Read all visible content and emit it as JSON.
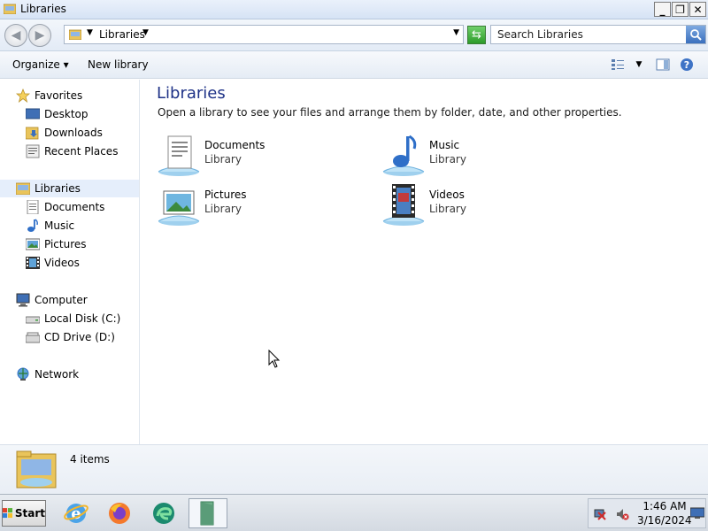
{
  "window": {
    "title": "Libraries",
    "minimize_label": "_",
    "maximize_label": "❐",
    "close_label": "✕"
  },
  "address": {
    "crumb": "Libraries",
    "search_placeholder": "Search Libraries"
  },
  "toolbar": {
    "organize_label": "Organize ▾",
    "new_library_label": "New library"
  },
  "nav": {
    "favorites": "Favorites",
    "desktop": "Desktop",
    "downloads": "Downloads",
    "recent_places": "Recent Places",
    "libraries": "Libraries",
    "documents": "Documents",
    "music": "Music",
    "pictures": "Pictures",
    "videos": "Videos",
    "computer": "Computer",
    "local_disk": "Local Disk (C:)",
    "cd_drive": "CD Drive (D:)",
    "network": "Network"
  },
  "content": {
    "title": "Libraries",
    "subtitle": "Open a library to see your files and arrange them by folder, date, and other properties.",
    "items": [
      {
        "name": "Documents",
        "type": "Library",
        "icon": "documents-library-icon"
      },
      {
        "name": "Music",
        "type": "Library",
        "icon": "music-library-icon"
      },
      {
        "name": "Pictures",
        "type": "Library",
        "icon": "pictures-library-icon"
      },
      {
        "name": "Videos",
        "type": "Library",
        "icon": "videos-library-icon"
      }
    ]
  },
  "details": {
    "count_text": "4 items"
  },
  "taskbar": {
    "start_label": "Start",
    "time": "1:46 AM",
    "date": "3/16/2024"
  }
}
